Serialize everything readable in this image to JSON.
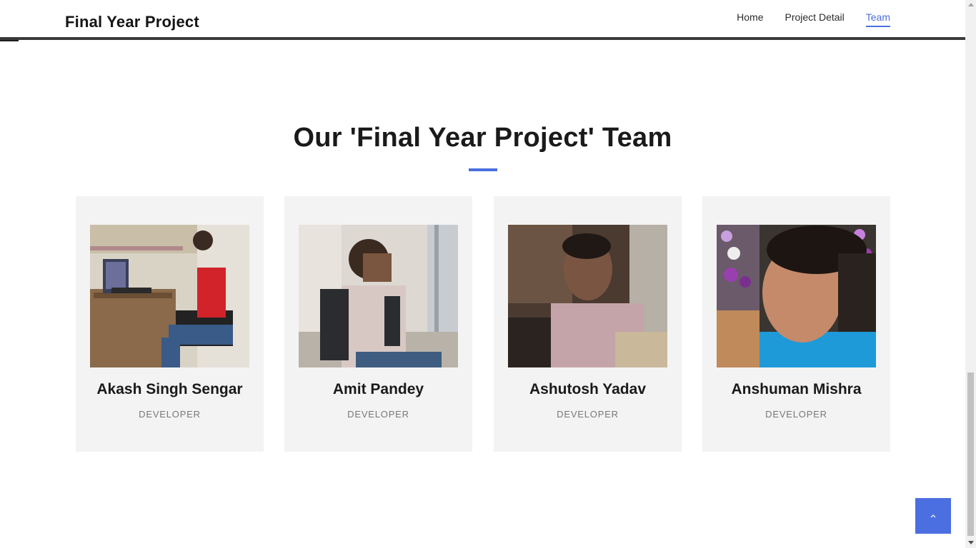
{
  "header": {
    "logo": "Final Year Project",
    "nav": [
      {
        "label": "Home",
        "active": false
      },
      {
        "label": "Project Detail",
        "active": false
      },
      {
        "label": "Team",
        "active": true
      }
    ]
  },
  "team": {
    "title": "Our 'Final Year Project' Team",
    "members": [
      {
        "name": "Akash Singh Sengar",
        "role": "DEVELOPER"
      },
      {
        "name": "Amit Pandey",
        "role": "DEVELOPER"
      },
      {
        "name": "Ashutosh Yadav",
        "role": "DEVELOPER"
      },
      {
        "name": "Anshuman Mishra",
        "role": "DEVELOPER"
      }
    ]
  },
  "back_to_top": {
    "icon": "chevron-up-icon"
  },
  "colors": {
    "accent": "#4b6fe0",
    "card_bg": "#f3f3f3",
    "header_rule": "#3a3a3a"
  }
}
